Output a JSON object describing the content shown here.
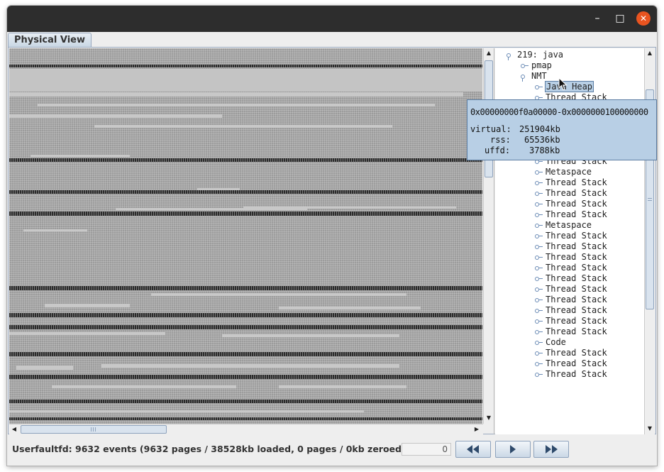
{
  "window": {
    "title": "",
    "controls": {
      "minimize": "–",
      "maximize": "□",
      "close": "✕"
    }
  },
  "tab": {
    "label": "Physical View"
  },
  "tree": {
    "root": "219: java",
    "children": [
      "pmap",
      "NMT"
    ],
    "nmt_items": [
      "Java Heap",
      "Thread Stack",
      "Thread Stack",
      "Thread Stack",
      "Thread Stack",
      "Thread Stack",
      "Thread Stack",
      "Thread Stack",
      "Metaspace",
      "Thread Stack",
      "Thread Stack",
      "Thread Stack",
      "Thread Stack",
      "Metaspace",
      "Thread Stack",
      "Thread Stack",
      "Thread Stack",
      "Thread Stack",
      "Thread Stack",
      "Thread Stack",
      "Thread Stack",
      "Thread Stack",
      "Thread Stack",
      "Thread Stack",
      "Code",
      "Thread Stack",
      "Thread Stack",
      "Thread Stack"
    ],
    "selected": "Java Heap"
  },
  "tooltip": {
    "range": "0x00000000f0a00000-0x0000000100000000",
    "virtual_label": "virtual:",
    "virtual_value": "251904kb",
    "rss_label": "rss:",
    "rss_value": "65536kb",
    "uffd_label": "uffd:",
    "uffd_value": "3788kb"
  },
  "status": {
    "text": "Userfaultfd: 9632 events (9632 pages / 38528kb loaded, 0 pages / 0kb zeroed)",
    "counter": "0"
  },
  "icons": {
    "rewind": "rewind-icon",
    "play": "play-icon",
    "fast_forward": "fast-forward-icon",
    "cursor": "mouse-pointer-icon"
  },
  "colors": {
    "titlebar": "#2d2d2d",
    "close": "#e95420",
    "selection": "#b8cfe5",
    "accent_border": "#5b7da3",
    "page_grey": "#9c9c9c",
    "page_dark": "#2b2b2b",
    "page_light": "#c4c4c4"
  }
}
